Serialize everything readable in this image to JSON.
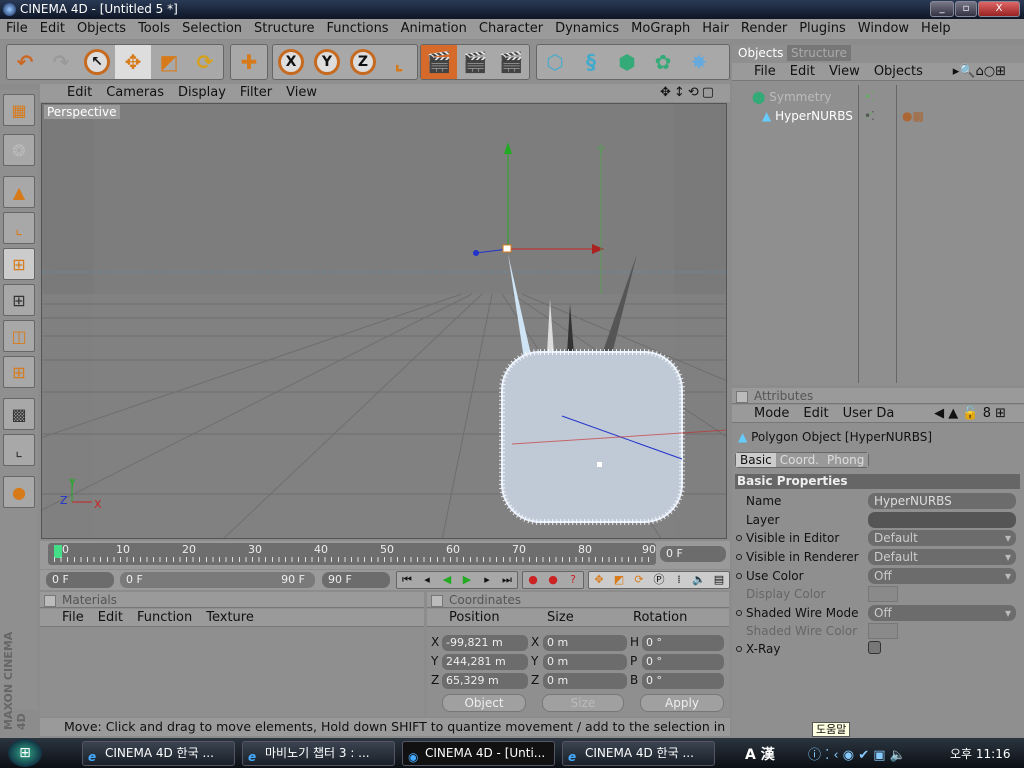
{
  "window": {
    "title": "CINEMA 4D - [Untitled 5 *]"
  },
  "menu": [
    "File",
    "Edit",
    "Objects",
    "Tools",
    "Selection",
    "Structure",
    "Functions",
    "Animation",
    "Character",
    "Dynamics",
    "MoGraph",
    "Hair",
    "Render",
    "Plugins",
    "Window",
    "Help"
  ],
  "toolbar": {
    "axis_x": "X",
    "axis_y": "Y",
    "axis_z": "Z"
  },
  "viewport": {
    "menu": [
      "Edit",
      "Cameras",
      "Display",
      "Filter",
      "View"
    ],
    "label": "Perspective"
  },
  "timeline": {
    "ticks": [
      "0",
      "10",
      "20",
      "30",
      "40",
      "50",
      "60",
      "70",
      "80",
      "90"
    ],
    "current": "0 F",
    "start": "0 F",
    "range_start": "0 F",
    "range_end": "90 F",
    "end": "90 F",
    "progress": 0
  },
  "materials": {
    "title": "Materials",
    "menu": [
      "File",
      "Edit",
      "Function",
      "Texture"
    ]
  },
  "coordinates": {
    "title": "Coordinates",
    "headers": [
      "Position",
      "Size",
      "Rotation"
    ],
    "rows": [
      {
        "pl": "X",
        "pv": "-99,821 m",
        "sl": "X",
        "sv": "0 m",
        "rl": "H",
        "rv": "0 °"
      },
      {
        "pl": "Y",
        "pv": "244,281 m",
        "sl": "Y",
        "sv": "0 m",
        "rl": "P",
        "rv": "0 °"
      },
      {
        "pl": "Z",
        "pv": "65,329 m",
        "sl": "Z",
        "sv": "0 m",
        "rl": "B",
        "rv": "0 °"
      }
    ],
    "mode": "Object",
    "size_mode": "Size",
    "apply": "Apply"
  },
  "status": "Move: Click and drag to move elements, Hold down SHIFT to quantize movement / add to the selection in point mod",
  "branding": "MAXON CINEMA 4D",
  "objects": {
    "tabs": [
      "Objects",
      "Structure"
    ],
    "menu": [
      "File",
      "Edit",
      "View",
      "Objects"
    ],
    "items": [
      {
        "name": "Symmetry"
      },
      {
        "name": "HyperNURBS"
      }
    ]
  },
  "attributes": {
    "title": "Attributes",
    "menu": [
      "Mode",
      "Edit",
      "User Da"
    ],
    "object": "Polygon Object [HyperNURBS]",
    "tabs": [
      "Basic",
      "Coord.",
      "Phong"
    ],
    "section": "Basic Properties",
    "fields": [
      {
        "label": "Name",
        "value": "HyperNURBS"
      },
      {
        "label": "Layer",
        "value": ""
      },
      {
        "label": "Visible in Editor",
        "value": "Default"
      },
      {
        "label": "Visible in Renderer",
        "value": "Default"
      },
      {
        "label": "Use Color",
        "value": "Off"
      },
      {
        "label": "Display Color",
        "value": ""
      },
      {
        "label": "Shaded Wire Mode",
        "value": "Off"
      },
      {
        "label": "Shaded Wire Color",
        "value": ""
      },
      {
        "label": "X-Ray",
        "value": ""
      }
    ]
  },
  "tooltip": "도움말",
  "taskbar": {
    "tasks": [
      "CINEMA 4D 한국 ...",
      "마비노기 챕터 3 : ...",
      "CINEMA 4D - [Unti...",
      "CINEMA 4D 한국 ..."
    ],
    "tray_lang": "A 漢",
    "clock": "오후 11:16"
  },
  "colors": {
    "accent": "#d77a1a",
    "bg": "#8f8f8f",
    "axis_x": "#cc2222",
    "axis_y": "#22aa22",
    "axis_z": "#2233cc"
  }
}
